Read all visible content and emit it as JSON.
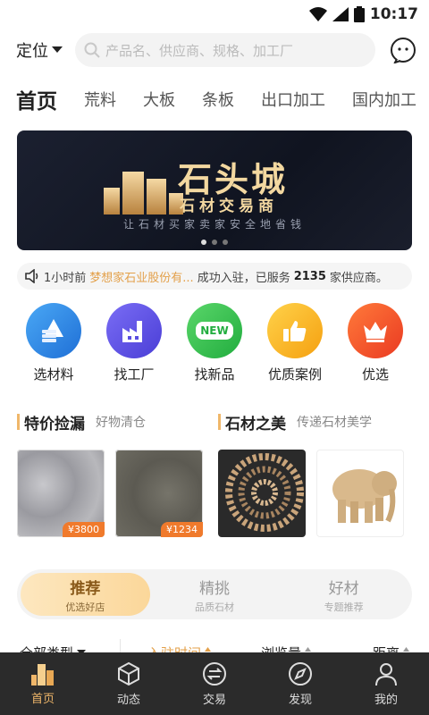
{
  "status": {
    "time": "10:17"
  },
  "header": {
    "location_label": "定位",
    "search_placeholder": "产品名、供应商、规格、加工厂"
  },
  "tabs": [
    {
      "label": "首页",
      "active": true
    },
    {
      "label": "荒料"
    },
    {
      "label": "大板"
    },
    {
      "label": "条板"
    },
    {
      "label": "出口加工"
    },
    {
      "label": "国内加工"
    }
  ],
  "banner": {
    "title": "石头城",
    "subtitle": "石材交易商",
    "slogan": "让石材买家卖家安全地省钱",
    "dots": 3,
    "active_dot": 0
  },
  "notice": {
    "time": "1小时前",
    "company": "梦想家石业股份有...",
    "text1": "成功入驻，已服务",
    "count": "2135",
    "text2": "家供应商。"
  },
  "quick_icons": [
    {
      "label": "选材料",
      "icon": "layers-icon",
      "color": "#2a86e8"
    },
    {
      "label": "找工厂",
      "icon": "factory-icon",
      "color": "#5a4ee0"
    },
    {
      "label": "找新品",
      "icon": "new-badge-icon",
      "color": "#2ec44a",
      "badge": "NEW"
    },
    {
      "label": "优质案例",
      "icon": "thumbs-up-icon",
      "color": "#f5b020"
    },
    {
      "label": "优选",
      "icon": "crown-icon",
      "color": "#f04a2a"
    }
  ],
  "sections": {
    "deals": {
      "title": "特价捡漏",
      "subtitle": "好物清仓",
      "items": [
        {
          "price": "¥3800"
        },
        {
          "price": "¥1234"
        }
      ]
    },
    "beauty": {
      "title": "石材之美",
      "subtitle": "传递石材美学"
    }
  },
  "segments": [
    {
      "main": "推荐",
      "sub": "优选好店",
      "active": true
    },
    {
      "main": "精挑",
      "sub": "品质石材"
    },
    {
      "main": "好材",
      "sub": "专题推荐"
    }
  ],
  "filters": {
    "type": "全部类型",
    "sort1": "入驻时间",
    "sort2": "浏览量",
    "sort3": "距离"
  },
  "nav": [
    {
      "label": "首页",
      "icon": "home-building-icon",
      "active": true
    },
    {
      "label": "动态",
      "icon": "cube-icon"
    },
    {
      "label": "交易",
      "icon": "exchange-icon"
    },
    {
      "label": "发现",
      "icon": "compass-icon"
    },
    {
      "label": "我的",
      "icon": "user-icon"
    }
  ],
  "colors": {
    "accent": "#f0b76a",
    "price": "#f07a2c",
    "nav_bg": "#2b2b2b"
  }
}
